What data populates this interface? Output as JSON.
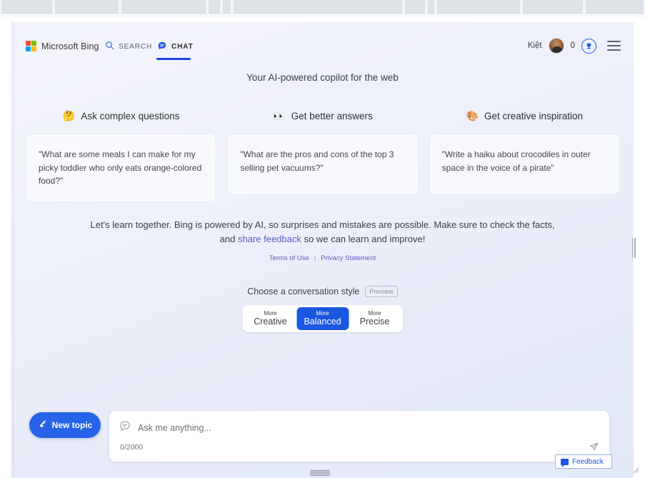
{
  "browser": {
    "segments": [
      0,
      75,
      168,
      290,
      310,
      325,
      565,
      597,
      610,
      730,
      818
    ]
  },
  "header": {
    "logo_text": "Microsoft Bing",
    "logo_colors": [
      "#f25022",
      "#7fba00",
      "#00a4ef",
      "#ffb900"
    ],
    "tabs": [
      {
        "id": "search",
        "label": "SEARCH",
        "icon": "search-icon",
        "active": false
      },
      {
        "id": "chat",
        "label": "CHAT",
        "icon": "chat-bubble-icon",
        "active": true
      }
    ],
    "accent_color": "#174ae4",
    "user_name": "Kiệt",
    "rewards_count": "0",
    "rewards_icon": "rewards-trophy-icon",
    "menu_icon": "hamburger-menu-icon"
  },
  "main": {
    "tagline": "Your AI-powered copilot for the web",
    "suggestions": [
      {
        "emoji": "🤔",
        "emoji_name": "thinking-face-emoji",
        "heading": "Ask complex questions",
        "example": "\"What are some meals I can make for my picky toddler who only eats orange-colored food?\""
      },
      {
        "emoji": "👀",
        "emoji_name": "eyes-emoji",
        "heading": "Get better answers",
        "example": "\"What are the pros and cons of the top 3 selling pet vacuums?\""
      },
      {
        "emoji": "🎨",
        "emoji_name": "artist-palette-emoji",
        "heading": "Get creative inspiration",
        "example": "\"Write a haiku about crocodiles in outer space in the voice of a pirate\""
      }
    ],
    "disclaimer_part1": "Let's learn together. Bing is powered by AI, so surprises and mistakes are possible. Make sure to check the facts, and ",
    "disclaimer_link": "share feedback",
    "disclaimer_part2": " so we can learn and improve!",
    "terms_label": "Terms of Use",
    "legal_separator": "|",
    "privacy_label": "Privacy Statement",
    "link_color": "#5b5fc7"
  },
  "conversation_style": {
    "label": "Choose a conversation style",
    "preview_badge": "Preview",
    "selected": "Balanced",
    "selected_color": "#1b57e0",
    "options": [
      {
        "prefix": "More",
        "name": "Creative",
        "selected": false
      },
      {
        "prefix": "More",
        "name": "Balanced",
        "selected": true
      },
      {
        "prefix": "More",
        "name": "Precise",
        "selected": false
      }
    ]
  },
  "composer": {
    "new_topic_label": "New topic",
    "new_topic_icon": "broom-icon",
    "new_topic_color": "#2663e8",
    "chat_icon": "chat-bubble-outline-icon",
    "placeholder": "Ask me anything...",
    "char_count": "0/2000",
    "send_icon": "send-paper-plane-icon"
  },
  "feedback": {
    "label": "Feedback",
    "icon": "feedback-speech-bubble-icon",
    "color": "#1a56e8"
  }
}
